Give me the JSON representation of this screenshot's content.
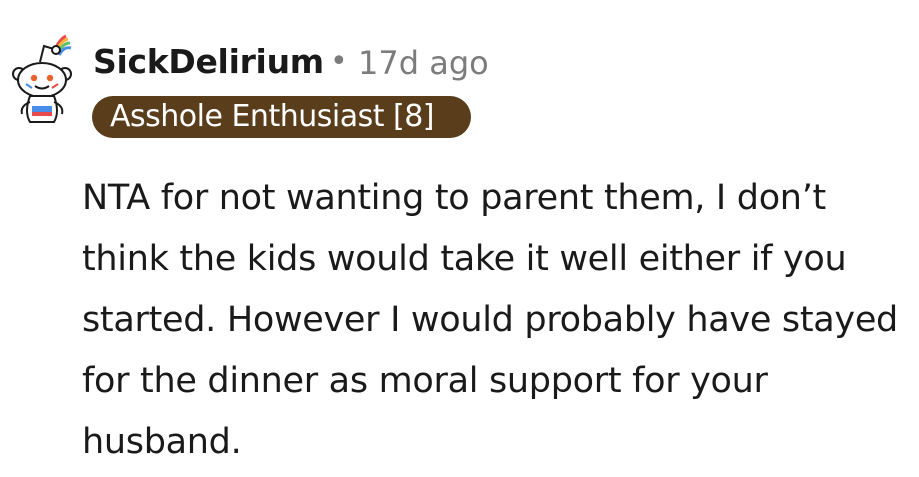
{
  "comment": {
    "author": "SickDelirium",
    "separator": "•",
    "timestamp": "17d ago",
    "flair": "Asshole Enthusiast [8]",
    "body": "NTA for not wanting to parent them, I don’t think the kids would take it well either if you started. However I would probably have stayed for the dinner as moral support for your husband."
  },
  "icons": {
    "avatar": "snoo-avatar-icon"
  },
  "colors": {
    "flair_background": "#5a3e1b",
    "flair_text": "#ffffff",
    "timestamp": "#7c7c7c",
    "text": "#1a1a1b"
  }
}
